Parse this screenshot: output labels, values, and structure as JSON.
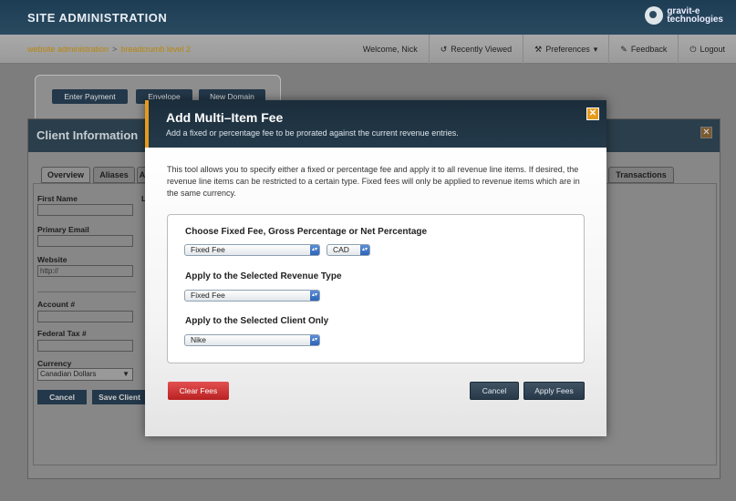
{
  "header": {
    "site_title": "SITE ADMINISTRATION",
    "logo_line1": "gravit-e",
    "logo_line2": "technologies"
  },
  "nav": {
    "breadcrumb": [
      "website administration",
      "breadcrumb level 2"
    ],
    "breadcrumb_sep": ">",
    "welcome": "Welcome, Nick",
    "recently_viewed": "Recently Viewed",
    "preferences": "Preferences",
    "feedback": "Feedback",
    "logout": "Logout"
  },
  "background": {
    "buttons": [
      "Enter Payment",
      "Envelope",
      "New Domain"
    ],
    "client_title": "Client Information",
    "tabs": [
      "Overview",
      "Aliases",
      "A",
      "Transactions"
    ],
    "fields": {
      "first_name": "First Name",
      "primary_email": "Primary Email",
      "website": "Website",
      "website_placeholder": "http://",
      "account": "Account #",
      "federal_tax": "Federal Tax #",
      "currency": "Currency",
      "currency_value": "Canadian Dollars"
    },
    "cancel": "Cancel",
    "save_client": "Save Client"
  },
  "modal": {
    "title": "Add Multi–Item Fee",
    "subtitle": "Add a fixed or percentage fee to be prorated against the current revenue entries.",
    "intro": "This tool allows you to specify either a fixed or percentage fee and apply it to all revenue line items.  If desired, the revenue line items can be restricted to a certain type.  Fixed fees will only be applied to revenue items which are in the same currency.",
    "section1_label": "Choose Fixed Fee, Gross Percentage or Net Percentage",
    "fee_type_value": "Fixed Fee",
    "currency_value": "CAD",
    "section2_label": "Apply to the Selected Revenue Type",
    "revenue_type_value": "Fixed Fee",
    "section3_label": "Apply to the Selected Client Only",
    "client_value": "Nike",
    "clear_fees": "Clear Fees",
    "cancel": "Cancel",
    "apply_fees": "Apply Fees"
  },
  "colors": {
    "accent_orange": "#e59a1c",
    "header_navy": "#1d3d55",
    "clear_red": "#c62a2a"
  }
}
